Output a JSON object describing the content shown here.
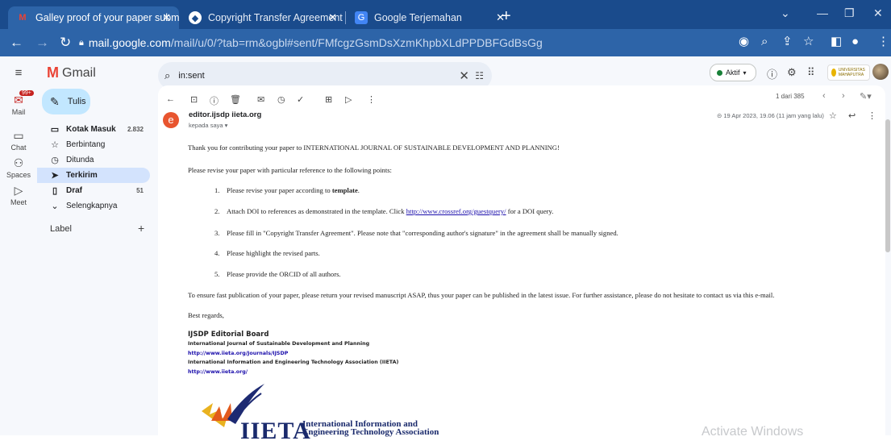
{
  "browser": {
    "tabs": [
      {
        "label": "Galley proof of your paper subm"
      },
      {
        "label": "Copyright Transfer Agreement"
      },
      {
        "label": "Google Terjemahan"
      }
    ],
    "url_domain": "mail.google.com",
    "url_path": "/mail/u/0/?tab=rm&ogbl#sent/FMfcgzGsmDsXzmKhpbXLdPPDBFGdBsGg"
  },
  "gmail": {
    "logo_text": "Gmail",
    "search_value": "in:sent",
    "status_label": "Aktif",
    "university_logo_text": "UNIVERSITAS MAHAPUTRA",
    "rail": [
      {
        "label": "Mail",
        "badge": "99+"
      },
      {
        "label": "Chat"
      },
      {
        "label": "Spaces"
      },
      {
        "label": "Meet"
      }
    ],
    "compose_label": "Tulis",
    "nav": [
      {
        "label": "Kotak Masuk",
        "count": "2.832"
      },
      {
        "label": "Berbintang",
        "count": ""
      },
      {
        "label": "Ditunda",
        "count": ""
      },
      {
        "label": "Terkirim",
        "count": ""
      },
      {
        "label": "Draf",
        "count": "51"
      },
      {
        "label": "Selengkapnya",
        "count": ""
      }
    ],
    "labels_heading": "Label",
    "pager": "1 dari 385"
  },
  "email": {
    "avatar_letter": "e",
    "from": "editor.ijsdp iieta.org",
    "to": "kepada saya",
    "date": "19 Apr 2023, 19.06 (11 jam yang lalu)",
    "intro": "Thank you for contributing your paper to INTERNATIONAL JOURNAL OF SUSTAINABLE DEVELOPMENT AND PLANNING!",
    "revise": "Please revise your paper with particular reference to the following points:",
    "points": {
      "p1_num": "1.",
      "p1_text": "Please revise your paper according to ",
      "p1_bold": "template",
      "p1_end": ".",
      "p2_num": "2.",
      "p2_text": "Attach DOI to references as demonstrated in the template. Click ",
      "p2_link": "http://www.crossref.org/guestquery/",
      "p2_end": " for a DOI query.",
      "p3_num": "3.",
      "p3_text": "Please fill in \"Copyright Transfer Agreement\". Please note that \"corresponding author's signature\" in the agreement shall be manually signed.",
      "p4_num": "4.",
      "p4_text": "Please highlight the revised parts.",
      "p5_num": "5.",
      "p5_text": "Please provide the ORCID of all authors."
    },
    "closing_note": "To ensure fast publication of your paper, please return your revised manuscript ASAP, thus your paper can be published in the latest issue.  For further assistance, please do not hesitate to contact us via this e-mail.",
    "regards": "Best regards,",
    "sig_board": "IJSDP Editorial Board",
    "sig_journal": "International Journal of Sustainable Development and Planning",
    "sig_link1": "http://www.iieta.org/Journals/IJSDP",
    "sig_assoc": "International Information and Engineering Technology Association (IIETA)",
    "sig_link2": "http://www.iieta.org/",
    "logo_big": "IIETA",
    "logo_line1": "International Information and",
    "logo_line2": "Engineering Technology Association"
  },
  "watermark": "Activate Windows",
  "colors": {
    "accent": "#0b57d0",
    "selected_nav": "#d3e3fd",
    "compose": "#c2e7ff",
    "tabbar": "#1a4b8c"
  }
}
